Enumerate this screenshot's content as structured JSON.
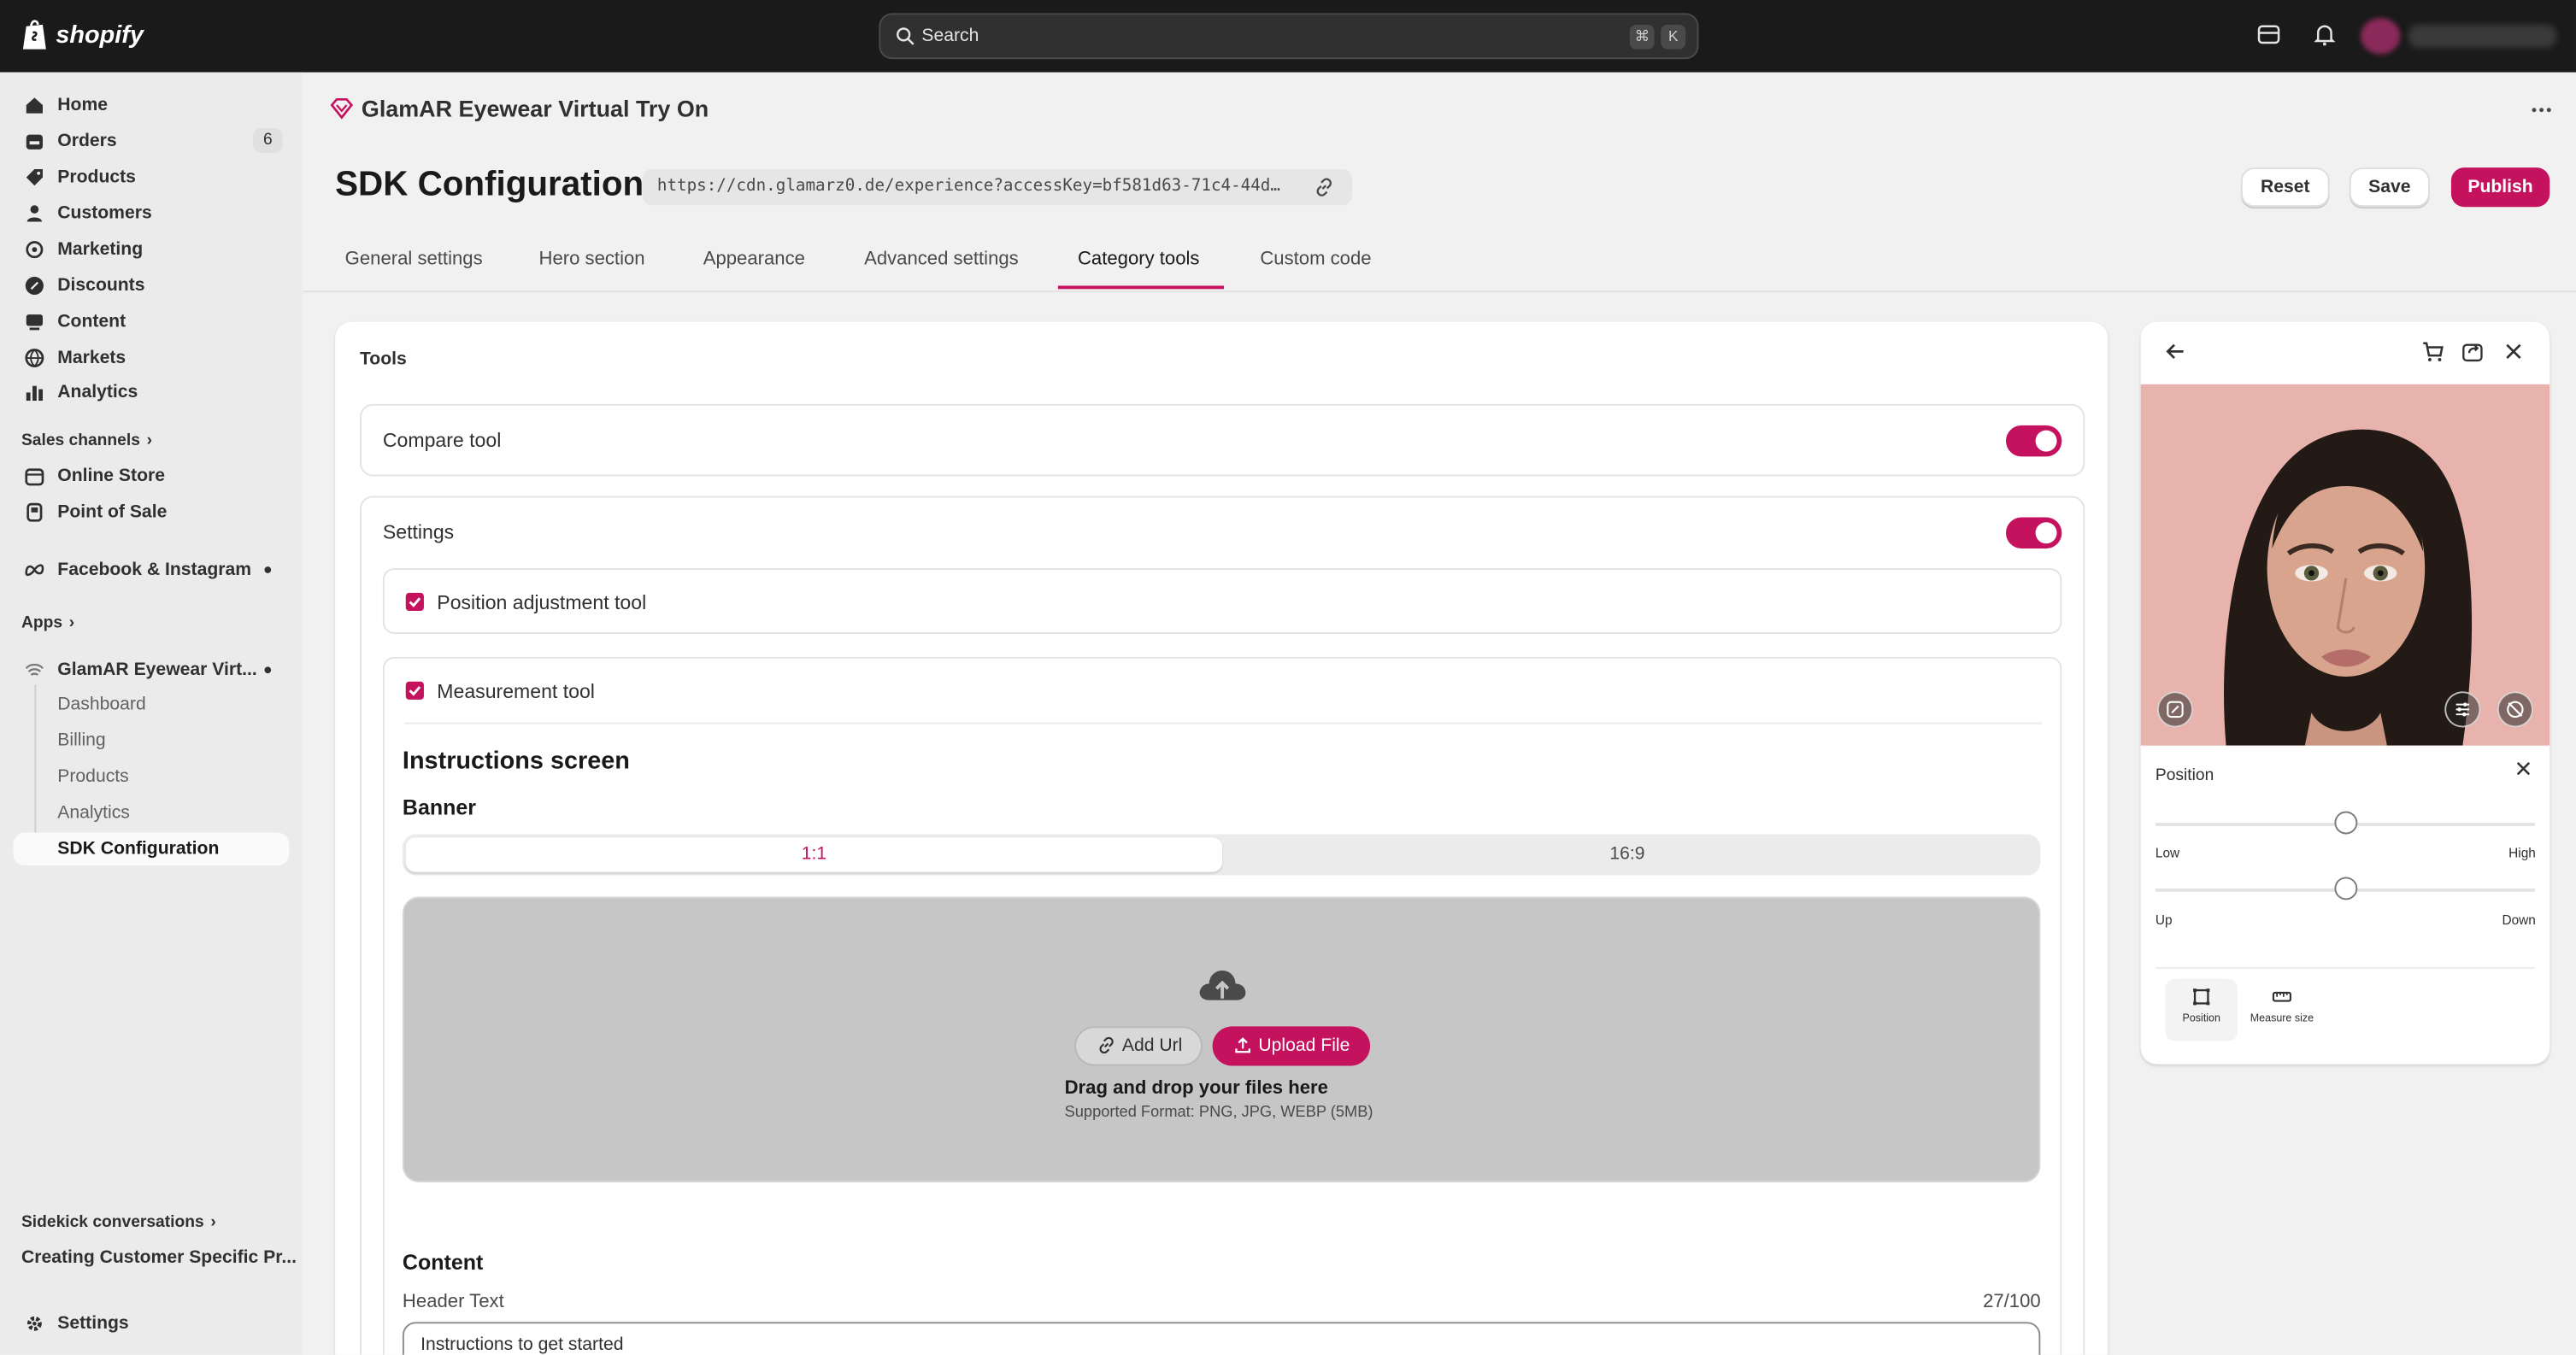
{
  "topbar": {
    "brand": "shopify",
    "search_placeholder": "Search",
    "shortcut_keys": [
      "⌘",
      "K"
    ]
  },
  "sidebar": {
    "items": [
      {
        "label": "Home",
        "icon": "home-icon"
      },
      {
        "label": "Orders",
        "icon": "orders-icon",
        "count": "6"
      },
      {
        "label": "Products",
        "icon": "tag-icon"
      },
      {
        "label": "Customers",
        "icon": "person-icon"
      },
      {
        "label": "Marketing",
        "icon": "target-icon"
      },
      {
        "label": "Discounts",
        "icon": "discount-icon"
      },
      {
        "label": "Content",
        "icon": "content-icon"
      },
      {
        "label": "Markets",
        "icon": "globe-icon"
      },
      {
        "label": "Analytics",
        "icon": "bar-chart-icon"
      }
    ],
    "sales_channels_heading": "Sales channels",
    "channels": [
      {
        "label": "Online Store",
        "icon": "store-icon"
      },
      {
        "label": "Point of Sale",
        "icon": "pos-icon"
      }
    ],
    "facebook": "Facebook & Instagram",
    "apps_heading": "Apps",
    "app_name": "GlamAR Eyewear Virt...",
    "app_subitems": [
      "Dashboard",
      "Billing",
      "Products",
      "Analytics",
      "SDK Configuration"
    ],
    "sidekick_heading": "Sidekick conversations",
    "sidekick_item": "Creating Customer Specific Pr...",
    "settings": "Settings"
  },
  "app_header": {
    "title": "GlamAR Eyewear Virtual Try On"
  },
  "page": {
    "title": "SDK Configuration",
    "url": "https://cdn.glamarz0.de/experience?accessKey=bf581d63-71c4-44d…",
    "actions": {
      "reset": "Reset",
      "save": "Save",
      "publish": "Publish"
    }
  },
  "tabs": [
    "General settings",
    "Hero section",
    "Appearance",
    "Advanced settings",
    "Category tools",
    "Custom code"
  ],
  "active_tab": "Category tools",
  "tools_card": {
    "title": "Tools",
    "compare_tool": {
      "label": "Compare tool",
      "enabled": true
    },
    "settings": {
      "label": "Settings",
      "enabled": true
    },
    "position_tool": {
      "label": "Position adjustment tool",
      "checked": true
    },
    "measurement_tool": {
      "label": "Measurement tool",
      "checked": true
    },
    "instructions_heading": "Instructions screen",
    "banner_heading": "Banner",
    "banner_ratios": [
      "1:1",
      "16:9"
    ],
    "selected_ratio": "1:1",
    "dropzone": {
      "add_url": "Add Url",
      "upload_file": "Upload File",
      "drag_text": "Drag and drop your files here",
      "formats": "Supported Format: PNG, JPG, WEBP (5MB)"
    },
    "content_heading": "Content",
    "header_text_label": "Header Text",
    "header_text_counter": "27/100",
    "header_text_value": "Instructions to get started"
  },
  "preview": {
    "panel_title": "Position",
    "slider1": {
      "low": "Low",
      "high": "High",
      "value": 0.5
    },
    "slider2": {
      "low": "Up",
      "high": "Down",
      "value": 0.5
    },
    "modes": [
      "Position",
      "Measure size"
    ],
    "active_mode": "Position"
  },
  "colors": {
    "accent": "#c5125f",
    "topbar": "#1a1a1a",
    "sidebar": "#ebebeb",
    "photo_bg": "#e9b3ad"
  }
}
